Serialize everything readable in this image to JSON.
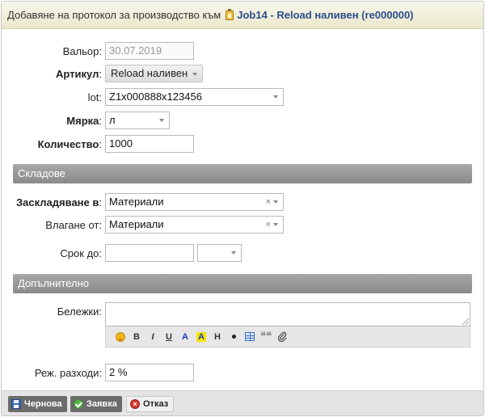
{
  "title": {
    "prefix": "Добавяне на протокол за производство към",
    "link": "Job14 - Reload наливен (re000000)"
  },
  "form": {
    "valor": {
      "label": "Вальор:",
      "value": "30.07.2019"
    },
    "article": {
      "label": "Артикул",
      "colon": ":",
      "value": "Reload наливен"
    },
    "lot": {
      "label": "lot:",
      "value": "Z1x000888x123456"
    },
    "measure": {
      "label": "Мярка",
      "colon": ":",
      "value": "л"
    },
    "quantity": {
      "label": "Количество",
      "colon": ":",
      "value": "1000"
    }
  },
  "section_stores": {
    "title": "Складове"
  },
  "stores": {
    "store_in": {
      "label": "Заскладяване в",
      "colon": ":",
      "value": "Материали",
      "clear": "×"
    },
    "store_from": {
      "label": "Влагане от:",
      "value": "Материали",
      "clear": "×"
    },
    "deadline": {
      "label": "Срок до:",
      "date_value": "",
      "time_value": ""
    }
  },
  "section_additional": {
    "title": "Допълнително"
  },
  "additional": {
    "notes": {
      "label": "Бележки:",
      "value": ""
    },
    "toolbar": {
      "bold": "B",
      "italic": "I",
      "underline": "U",
      "color": "A",
      "highlight": "A",
      "heading": "H",
      "quote": "❝❝"
    },
    "overhead": {
      "label": "Реж. разходи:",
      "value": "2 %"
    }
  },
  "footer": {
    "draft": "Чернова",
    "request": "Заявка",
    "cancel": "Отказ"
  },
  "colors": {
    "title_bg": "#ebe8cd",
    "link": "#2a4f8c",
    "section_bg": "#8a8a8a",
    "footer_button": "#6b6b6b"
  }
}
